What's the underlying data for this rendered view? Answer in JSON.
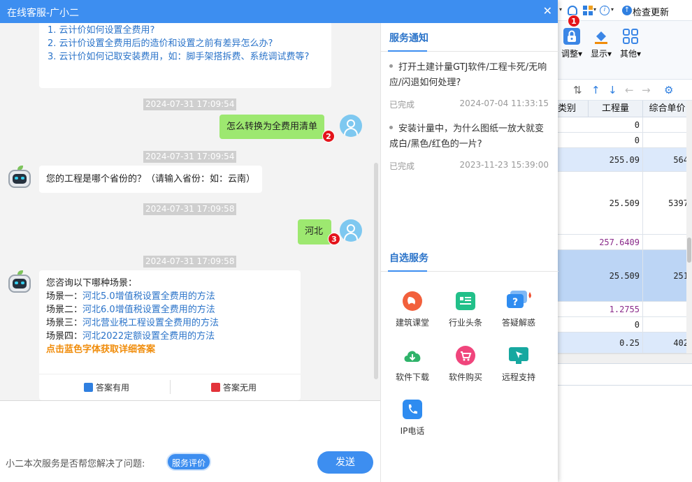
{
  "bg_app": {
    "toolbar": {
      "update_label": "检查更新"
    },
    "ribbon": {
      "adjust": "调整▾",
      "display": "显示▾",
      "other": "其他▾"
    },
    "table": {
      "headers": [
        "类别",
        "工程量",
        "综合单价"
      ],
      "rows": [
        {
          "qty": "0",
          "price": ""
        },
        {
          "qty": "0",
          "price": ""
        },
        {
          "qty": "255.09",
          "price": "564"
        },
        {
          "qty": "25.509",
          "price": "5397"
        },
        {
          "qty": "257.6409",
          "price": ""
        },
        {
          "qty": "25.509",
          "price": "251"
        },
        {
          "qty": "1.2755",
          "price": ""
        },
        {
          "qty": "0",
          "price": ""
        },
        {
          "qty": "0.25",
          "price": "402"
        }
      ]
    }
  },
  "badges": [
    "1",
    "2",
    "3"
  ],
  "chat": {
    "title": "在线客服-广小二",
    "faq": [
      "1. 云计价如何设置全费用?",
      "2. 云计价设置全费用后的造价和设置之前有差异怎么办?",
      "3. 云计价如何记取安装费用，如：脚手架搭拆费、系统调试费等?"
    ],
    "messages": [
      {
        "time": "2024-07-31 17:09:54",
        "text": "怎么转换为全费用清单"
      },
      {
        "time": "2024-07-31 17:09:54",
        "text": "您的工程是哪个省份的？（请输入省份：如：云南）"
      },
      {
        "time": "2024-07-31 17:09:58",
        "text": "河北"
      },
      {
        "time": "2024-07-31 17:09:58"
      }
    ],
    "scenario": {
      "intro": "您咨询以下哪种场景：",
      "items": [
        {
          "label": "场景一：",
          "link": "河北5.0增值税设置全费用的方法"
        },
        {
          "label": "场景二：",
          "link": "河北6.0增值税设置全费用的方法"
        },
        {
          "label": "场景三：",
          "link": "河北营业税工程设置全费用的方法"
        },
        {
          "label": "场景四：",
          "link": "河北2022定额设置全费用的方法"
        }
      ],
      "hint": "点击蓝色字体获取详细答案",
      "useful": "答案有用",
      "useless": "答案无用"
    },
    "input": {
      "value": "",
      "placeholder": ""
    },
    "eval_question": "小二本次服务是否帮您解决了问题:",
    "eval_button": "服务评价",
    "send_button": "发送"
  },
  "right_panel": {
    "notice_title": "服务通知",
    "notices": [
      {
        "text": "打开土建计量GTJ软件/工程卡死/无响应/闪退如何处理?",
        "status": "已完成",
        "date": "2024-07-04 11:33:15"
      },
      {
        "text": "安装计量中，为什么图纸一放大就变成白/黑色/红色的一片?",
        "status": "已完成",
        "date": "2023-11-23 15:39:00"
      }
    ],
    "service_title": "自选服务",
    "services": [
      {
        "label": "建筑课堂",
        "color": "#f2603c"
      },
      {
        "label": "行业头条",
        "color": "#22c08a"
      },
      {
        "label": "答疑解惑",
        "color": "#2f8cf0"
      },
      {
        "label": "软件下载",
        "color": "#2fb36a"
      },
      {
        "label": "软件购买",
        "color": "#f0457c"
      },
      {
        "label": "远程支持",
        "color": "#17a8a0"
      },
      {
        "label": "IP电话",
        "color": "#2f8cf0"
      }
    ]
  }
}
